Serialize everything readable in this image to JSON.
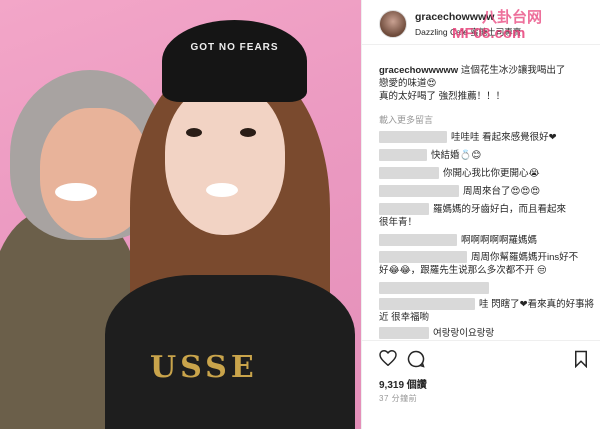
{
  "photo": {
    "cap_text": "GOT NO FEARS",
    "shirt_text": "USSE"
  },
  "watermark": {
    "line1": "八卦台网",
    "line2": "MF08.com"
  },
  "post": {
    "username": "gracechowwww",
    "location": "Dazzling Cafe 蜜糖土司專賣",
    "caption_user": "gracechowwwww",
    "caption_line1": "這個花生冰沙讓我喝出了",
    "caption_line2": "戀愛的味道😍",
    "caption_line3": "真的太好喝了 強烈推薦！！！",
    "load_more": "載入更多留言"
  },
  "comments": [
    {
      "text": "哇哇哇 看起來感覺很好❤"
    },
    {
      "text": "快結婚💍😊"
    },
    {
      "text": "你開心我比你更開心😭"
    },
    {
      "text": "周周來台了😍😍😍"
    },
    {
      "text": "羅媽媽的牙齒好白，而且看起來"
    },
    {
      "text": "很年青！"
    },
    {
      "text": "啊啊啊啊啊羅媽媽"
    },
    {
      "text": "周周你幫羅媽媽开ins好不"
    },
    {
      "text": "好😂😂，跟羅先生说那么多次都不开 😒"
    },
    {
      "text": "哇 閃瞎了❤看來真的好事將"
    },
    {
      "text": "近 很幸福喲"
    },
    {
      "text": "여랑랑이요랑랑"
    }
  ],
  "actions": {
    "like_icon": "heart-icon",
    "comment_icon": "comment-icon",
    "save_icon": "bookmark-icon"
  },
  "stats": {
    "likes": "9,319 個讚",
    "time_ago": "37 分鐘前"
  }
}
